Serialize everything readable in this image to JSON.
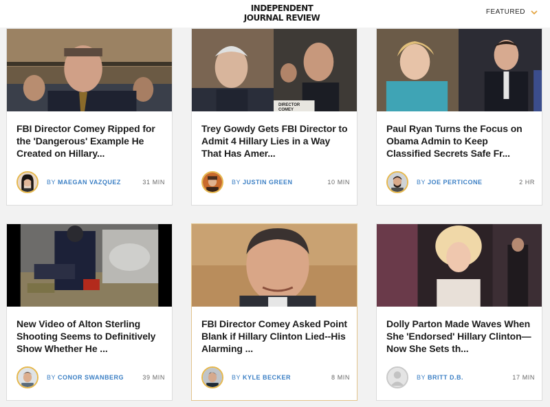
{
  "header": {
    "logo_line1": "INDEPENDENT",
    "logo_line2": "JOURNAL REVIEW",
    "featured_label": "FEATURED",
    "chevron_icon": "chevron-down-icon",
    "accent": "#e2a13a"
  },
  "colors": {
    "author_link": "#3b7fc4",
    "avatar_ring": "#e6b84d",
    "active_card_border": "#e2c38b"
  },
  "byline_prefix": "BY",
  "articles": [
    {
      "title": "FBI Director Comey Ripped for the 'Dangerous' Example He Created on Hillary...",
      "author": "MAEGAN VAZQUEZ",
      "time": "31 MIN"
    },
    {
      "title": "Trey Gowdy Gets FBI Director to Admit 4 Hillary Lies in a Way That Has Amer...",
      "author": "JUSTIN GREEN",
      "time": "10 MIN",
      "image_caption": "DIRECTOR COMEY"
    },
    {
      "title": "Paul Ryan Turns the Focus on Obama Admin to Keep Classified Secrets Safe Fr...",
      "author": "JOE PERTICONE",
      "time": "2 HR"
    },
    {
      "title": "New Video of Alton Sterling Shooting Seems to Definitively Show Whether He ...",
      "author": "CONOR SWANBERG",
      "time": "39 MIN"
    },
    {
      "title": "FBI Director Comey Asked Point Blank if Hillary Clinton Lied--His Alarming ...",
      "author": "KYLE BECKER",
      "time": "8 MIN"
    },
    {
      "title": "Dolly Parton Made Waves When She 'Endorsed' Hillary Clinton—Now She Sets th...",
      "author": "BRITT D.B.",
      "time": "17 MIN"
    }
  ]
}
